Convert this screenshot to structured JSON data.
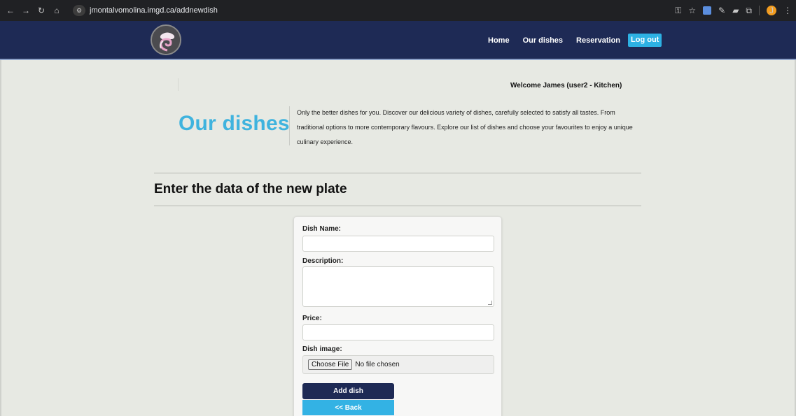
{
  "browser": {
    "url": "jmontalvomolina.imgd.ca/addnewdish",
    "profile_initial": "J"
  },
  "nav": {
    "home": "Home",
    "our_dishes": "Our dishes",
    "reservation": "Reservation",
    "logout": "Log out"
  },
  "welcome": "Welcome James (user2 - Kitchen)",
  "hero": {
    "title": "Our dishes",
    "intro": "Only the better dishes for you. Discover our delicious variety of dishes, carefully selected to satisfy all tastes. From traditional options to more contemporary flavours. Explore our list of dishes and choose your favourites to enjoy a unique culinary experience."
  },
  "section_title": "Enter the data of the new plate",
  "form": {
    "dish_name_label": "Dish Name:",
    "dish_name_value": "",
    "description_label": "Description:",
    "description_value": "",
    "price_label": "Price:",
    "price_value": "",
    "image_label": "Dish image:",
    "choose_file": "Choose File",
    "no_file": "No file chosen",
    "add_button": "Add dish",
    "back_button": "<< Back"
  },
  "colors": {
    "header_bg": "#1e2a55",
    "accent": "#3fb3de",
    "page_bg": "#e7e9e3"
  }
}
